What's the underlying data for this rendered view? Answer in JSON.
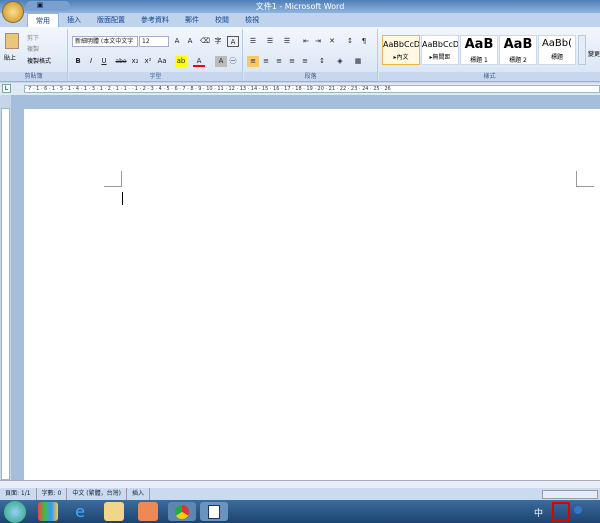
{
  "window": {
    "title": "文件1 - Microsoft Word"
  },
  "tabs": [
    "常用",
    "插入",
    "版面配置",
    "參考資料",
    "郵件",
    "校閱",
    "檢視"
  ],
  "clipboard": {
    "paste": "貼上",
    "cut": "剪下",
    "copy": "複製",
    "format_painter": "複製格式",
    "label": "剪貼簿"
  },
  "font": {
    "name": "新細明體 (本文中文字",
    "size": "12",
    "label": "字型",
    "grow": "A",
    "shrink": "A",
    "bold": "B",
    "italic": "I",
    "underline": "U",
    "strike": "abe",
    "sub": "x₂",
    "sup": "x²",
    "case": "Aa",
    "color": "A",
    "char_shade": "A"
  },
  "paragraph": {
    "label": "段落"
  },
  "styles": {
    "label": "樣式",
    "items": [
      {
        "sample": "AaBbCcD",
        "name": "▸內文"
      },
      {
        "sample": "AaBbCcD",
        "name": "▸無間距"
      },
      {
        "sample": "AaB",
        "name": "標題 1"
      },
      {
        "sample": "AaB",
        "name": "標題 2"
      },
      {
        "sample": "AaBb(",
        "name": "標題"
      }
    ],
    "change": "變更"
  },
  "ruler": "· 7 · 1 · 6 · 1 · 5 · 1 · 4 · 1 · 3 · 1 · 2 · 1 · 1 ·   · 1 · 2 · 3 · 4 · 5 · 6 · 7 · 8 · 9 · 10 · 11 · 12 · 13 · 14 · 15 · 16 · 17 · 18 · 19 · 20 · 21 · 22 · 23 · 24 · 25 · 26",
  "status": {
    "page": "頁面: 1/1",
    "words": "字數: 0",
    "language": "中文 (繁體，台灣)",
    "mode": "插入"
  },
  "taskbar": {
    "ime": "中",
    "highlight_color": "#e00000"
  }
}
